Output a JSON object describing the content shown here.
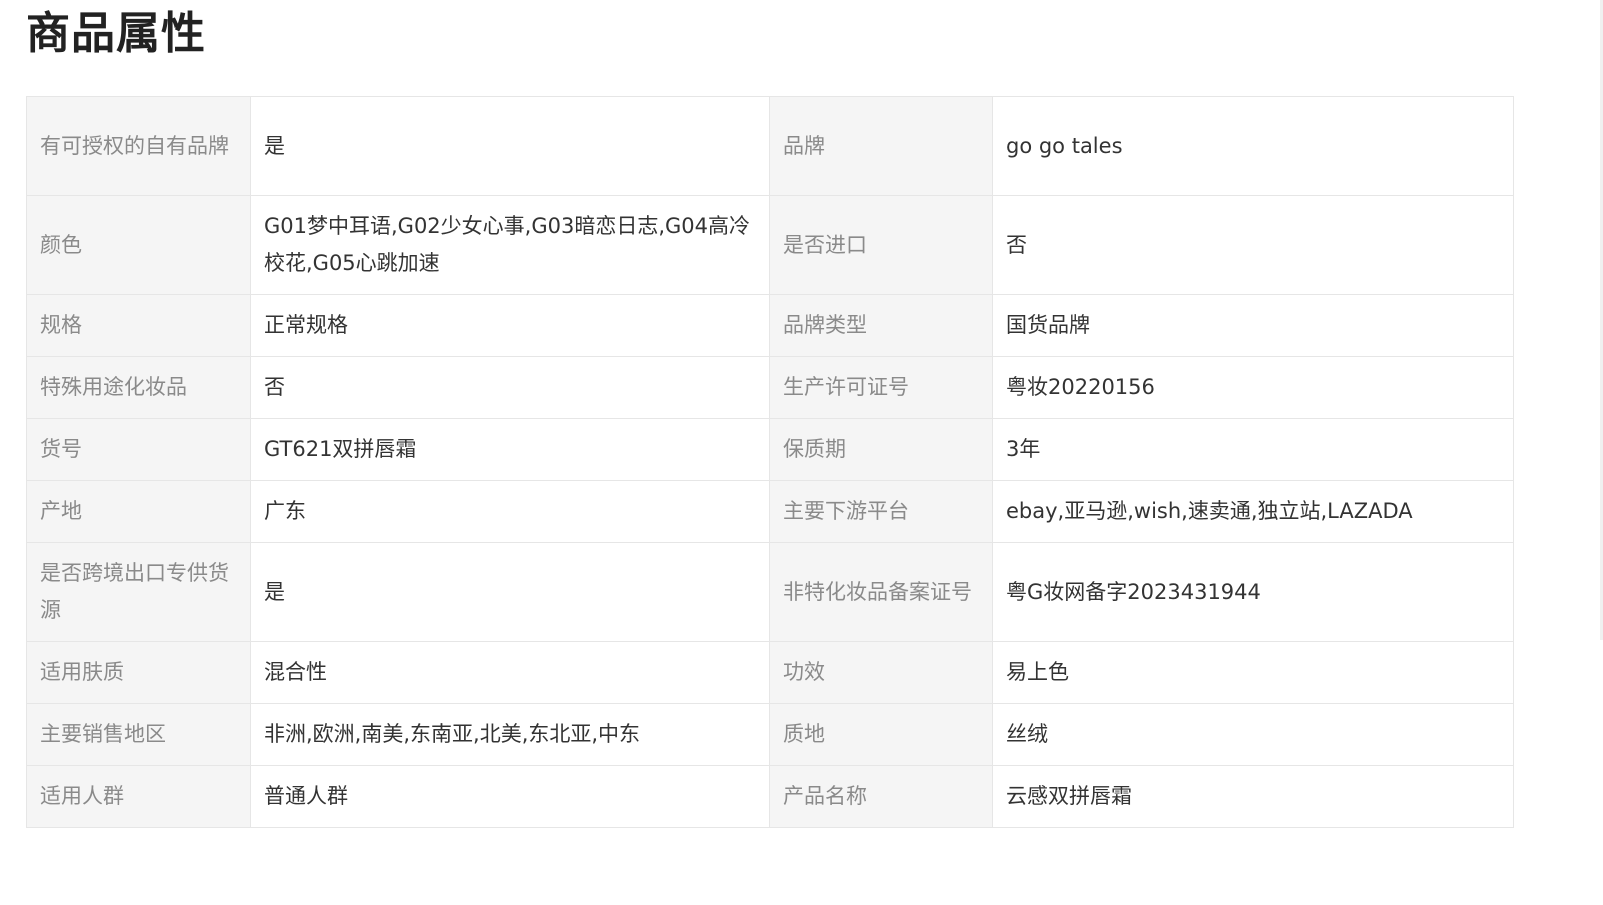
{
  "section": {
    "title": "商品属性"
  },
  "rows": [
    {
      "k1": "有可授权的自有品牌",
      "v1": "是",
      "k2": "品牌",
      "v2": "go go tales"
    },
    {
      "k1": "颜色",
      "v1": "G01梦中耳语,G02少女心事,G03暗恋日志,G04高冷校花,G05心跳加速",
      "k2": "是否进口",
      "v2": "否"
    },
    {
      "k1": "规格",
      "v1": "正常规格",
      "k2": "品牌类型",
      "v2": "国货品牌"
    },
    {
      "k1": "特殊用途化妆品",
      "v1": "否",
      "k2": "生产许可证号",
      "v2": "粤妆20220156"
    },
    {
      "k1": "货号",
      "v1": "GT621双拼唇霜",
      "k2": "保质期",
      "v2": "3年"
    },
    {
      "k1": "产地",
      "v1": "广东",
      "k2": "主要下游平台",
      "v2": "ebay,亚马逊,wish,速卖通,独立站,LAZADA"
    },
    {
      "k1": "是否跨境出口专供货源",
      "v1": "是",
      "k2": "非特化妆品备案证号",
      "v2": "粤G妆网备字2023431944"
    },
    {
      "k1": "适用肤质",
      "v1": "混合性",
      "k2": "功效",
      "v2": "易上色"
    },
    {
      "k1": "主要销售地区",
      "v1": "非洲,欧洲,南美,东南亚,北美,东北亚,中东",
      "k2": "质地",
      "v2": "丝绒"
    },
    {
      "k1": "适用人群",
      "v1": "普通人群",
      "k2": "产品名称",
      "v2": "云感双拼唇霜"
    }
  ]
}
